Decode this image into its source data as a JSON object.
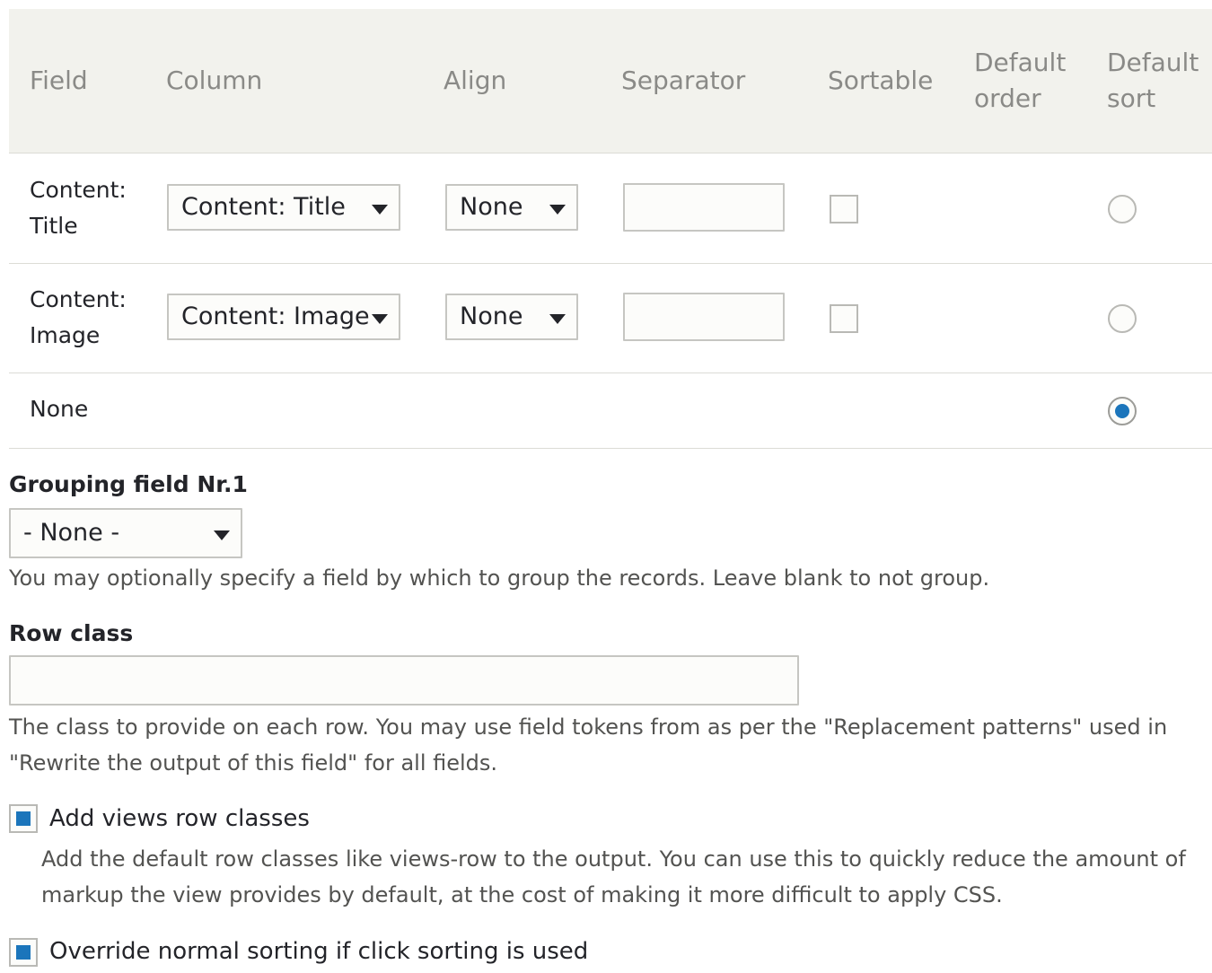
{
  "table": {
    "headers": {
      "field": "Field",
      "column": "Column",
      "align": "Align",
      "separator": "Separator",
      "sortable": "Sortable",
      "default_order_1": "Default",
      "default_order_2": "order",
      "default_sort_1": "Default",
      "default_sort_2": "sort"
    },
    "rows": [
      {
        "field_line1": "Content:",
        "field_line2": "Title",
        "column_value": "Content: Title",
        "align_value": "None",
        "separator_value": "",
        "sortable": false,
        "default_sort": false
      },
      {
        "field_line1": "Content:",
        "field_line2": "Image",
        "column_value": "Content: Image",
        "align_value": "None",
        "separator_value": "",
        "sortable": false,
        "default_sort": false
      },
      {
        "field_line1": "None",
        "default_sort": true
      }
    ]
  },
  "grouping": {
    "label": "Grouping field Nr.1",
    "value": "- None -",
    "description": "You may optionally specify a field by which to group the records. Leave blank to not group."
  },
  "row_class": {
    "label": "Row class",
    "value": "",
    "description_line1": "The class to provide on each row. You may use field tokens from as per the \"Replacement patterns\" used in",
    "description_line2": "\"Rewrite the output of this field\" for all fields."
  },
  "add_views_row_classes": {
    "label": "Add views row classes",
    "checked": true,
    "description_line1": "Add the default row classes like views-row to the output. You can use this to quickly reduce the amount of",
    "description_line2": "markup the view provides by default, at the cost of making it more difficult to apply CSS."
  },
  "override_sorting": {
    "label": "Override normal sorting if click sorting is used",
    "checked": true
  },
  "colors": {
    "accent": "#1b75bb",
    "header_bg": "#f2f2ed",
    "header_text": "#8a8a87",
    "border": "#dcdcd6"
  }
}
